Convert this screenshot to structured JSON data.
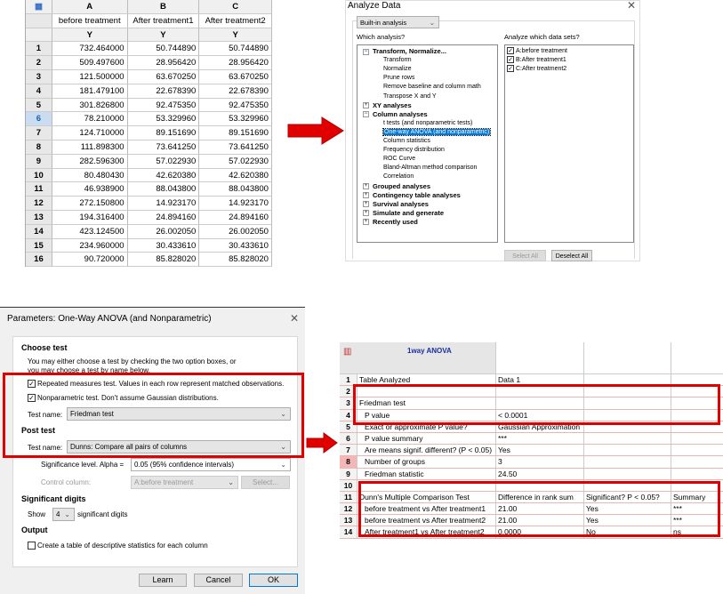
{
  "data_table": {
    "columns": [
      {
        "letter": "A",
        "name": "before treatment",
        "sub": "Y"
      },
      {
        "letter": "B",
        "name": "After treatment1",
        "sub": "Y"
      },
      {
        "letter": "C",
        "name": "After treatment2",
        "sub": "Y"
      }
    ],
    "selected_row": 6,
    "rows": [
      [
        "1",
        "732.464000",
        "50.744890",
        "50.744890"
      ],
      [
        "2",
        "509.497600",
        "28.956420",
        "28.956420"
      ],
      [
        "3",
        "121.500000",
        "63.670250",
        "63.670250"
      ],
      [
        "4",
        "181.479100",
        "22.678390",
        "22.678390"
      ],
      [
        "5",
        "301.826800",
        "92.475350",
        "92.475350"
      ],
      [
        "6",
        "78.210000",
        "53.329960",
        "53.329960"
      ],
      [
        "7",
        "124.710000",
        "89.151690",
        "89.151690"
      ],
      [
        "8",
        "111.898300",
        "73.641250",
        "73.641250"
      ],
      [
        "9",
        "282.596300",
        "57.022930",
        "57.022930"
      ],
      [
        "10",
        "80.480430",
        "42.620380",
        "42.620380"
      ],
      [
        "11",
        "46.938900",
        "88.043800",
        "88.043800"
      ],
      [
        "12",
        "272.150800",
        "14.923170",
        "14.923170"
      ],
      [
        "13",
        "194.316400",
        "24.894160",
        "24.894160"
      ],
      [
        "14",
        "423.124500",
        "26.002050",
        "26.002050"
      ],
      [
        "15",
        "234.960000",
        "30.433610",
        "30.433610"
      ],
      [
        "16",
        "90.720000",
        "85.828020",
        "85.828020"
      ]
    ]
  },
  "analyze_dialog": {
    "title": "Analyze Data",
    "category_select": "Built-in analysis",
    "which_analysis_label": "Which analysis?",
    "datasets_label": "Analyze which data sets?",
    "tree": [
      {
        "label": "Transform, Normalize...",
        "level": 0,
        "expanded": true
      },
      {
        "label": "Transform",
        "level": 1
      },
      {
        "label": "Normalize",
        "level": 1
      },
      {
        "label": "Prune rows",
        "level": 1
      },
      {
        "label": "Remove baseline and column math",
        "level": 1
      },
      {
        "label": "Transpose X and Y",
        "level": 1
      },
      {
        "label": "XY analyses",
        "level": 0,
        "expanded": false
      },
      {
        "label": "Column analyses",
        "level": 0,
        "expanded": true
      },
      {
        "label": "t tests (and nonparametric tests)",
        "level": 1
      },
      {
        "label": "One-way ANOVA (and nonparametric)",
        "level": 1,
        "selected": true
      },
      {
        "label": "Column statistics",
        "level": 1
      },
      {
        "label": "Frequency distribution",
        "level": 1
      },
      {
        "label": "ROC Curve",
        "level": 1
      },
      {
        "label": "Bland-Altman method comparison",
        "level": 1
      },
      {
        "label": "Correlation",
        "level": 1
      },
      {
        "label": "Grouped analyses",
        "level": 0,
        "expanded": false
      },
      {
        "label": "Contingency table analyses",
        "level": 0,
        "expanded": false
      },
      {
        "label": "Survival analyses",
        "level": 0,
        "expanded": false
      },
      {
        "label": "Simulate and generate",
        "level": 0,
        "expanded": false
      },
      {
        "label": "Recently used",
        "level": 0,
        "expanded": false
      }
    ],
    "datasets": [
      {
        "label": "A:before treatment",
        "checked": true
      },
      {
        "label": "B:After treatment1",
        "checked": true
      },
      {
        "label": "C:After treatment2",
        "checked": true
      }
    ],
    "select_all": "Select All",
    "deselect_all": "Deselect All"
  },
  "params_dialog": {
    "title": "Parameters: One-Way ANOVA (and Nonparametric)",
    "choose_test": "Choose test",
    "intro": "You may either choose a test by checking the two option boxes, or you may choose a test by name below.",
    "repeated_measures": "Repeated measures test. Values in each row represent matched observations.",
    "nonparametric": "Nonparametric test. Don't assume Gaussian distributions.",
    "test_name_label": "Test name:",
    "test_name": "Friedman test",
    "post_test": "Post test",
    "post_test_name": "Dunns: Compare all pairs of columns",
    "alpha_label": "Significance level. Alpha =",
    "alpha_value": "0.05   (95%  confidence intervals)",
    "control_label": "Control column:",
    "control_value": "A:before treatment",
    "select_button": "Select...",
    "sig_digits": "Significant digits",
    "show_label": "Show",
    "show_value": "4",
    "sig_digits_suffix": "significant digits",
    "output": "Output",
    "descriptive": "Create a table of descriptive statistics for each column",
    "learn": "Learn",
    "cancel": "Cancel",
    "ok": "OK"
  },
  "results": {
    "title": "1way ANOVA",
    "accent": "#e00000",
    "rows": [
      [
        "1",
        "Table Analyzed",
        "Data 1",
        "",
        ""
      ],
      [
        "2",
        "",
        "",
        "",
        ""
      ],
      [
        "3",
        "Friedman test",
        "",
        "",
        ""
      ],
      [
        "4",
        "  P value",
        "< 0.0001",
        "",
        ""
      ],
      [
        "5",
        "  Exact or approximate P value?",
        "Gaussian Approximation",
        "",
        ""
      ],
      [
        "6",
        "  P value summary",
        "***",
        "",
        ""
      ],
      [
        "7",
        "  Are means signif. different? (P < 0.05)",
        "Yes",
        "",
        ""
      ],
      [
        "8",
        "  Number of groups",
        "3",
        "",
        ""
      ],
      [
        "9",
        "  Friedman statistic",
        "24.50",
        "",
        ""
      ],
      [
        "10",
        "",
        "",
        "",
        ""
      ],
      [
        "11",
        "Dunn's Multiple Comparison Test",
        "Difference in rank sum",
        "Significant? P < 0.05?",
        "Summary"
      ],
      [
        "12",
        "  before treatment vs After treatment1",
        "21.00",
        "Yes",
        "***"
      ],
      [
        "13",
        "  before treatment vs After treatment2",
        "21.00",
        "Yes",
        "***"
      ],
      [
        "14",
        "  After treatment1 vs After treatment2",
        "0.0000",
        "No",
        "ns"
      ]
    ]
  }
}
